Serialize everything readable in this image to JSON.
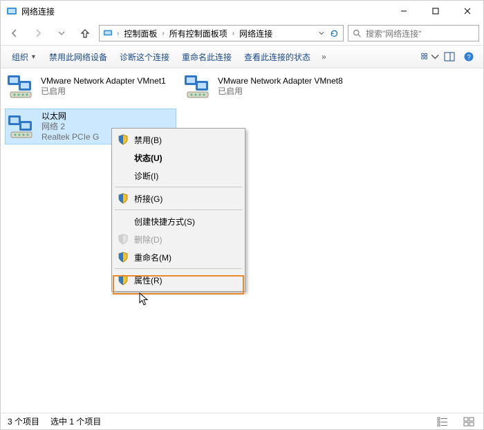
{
  "window": {
    "title": "网络连接"
  },
  "breadcrumb": {
    "items": [
      "控制面板",
      "所有控制面板项",
      "网络连接"
    ]
  },
  "search": {
    "placeholder": "搜索\"网络连接\""
  },
  "toolbar": {
    "organize": "组织",
    "disable_device": "禁用此网络设备",
    "diagnose": "诊断这个连接",
    "rename": "重命名此连接",
    "view_status": "查看此连接的状态"
  },
  "adapters": [
    {
      "name": "VMware Network Adapter VMnet1",
      "status": "已启用",
      "detail": ""
    },
    {
      "name": "VMware Network Adapter VMnet8",
      "status": "已启用",
      "detail": ""
    },
    {
      "name": "以太网",
      "status": "网络 2",
      "detail": "Realtek PCIe G"
    }
  ],
  "context_menu": {
    "disable": "禁用(B)",
    "status": "状态(U)",
    "diagnose": "诊断(I)",
    "bridge": "桥接(G)",
    "create_shortcut": "创建快捷方式(S)",
    "delete": "删除(D)",
    "rename": "重命名(M)",
    "properties": "属性(R)"
  },
  "statusbar": {
    "item_count": "3 个项目",
    "selected": "选中 1 个项目"
  }
}
